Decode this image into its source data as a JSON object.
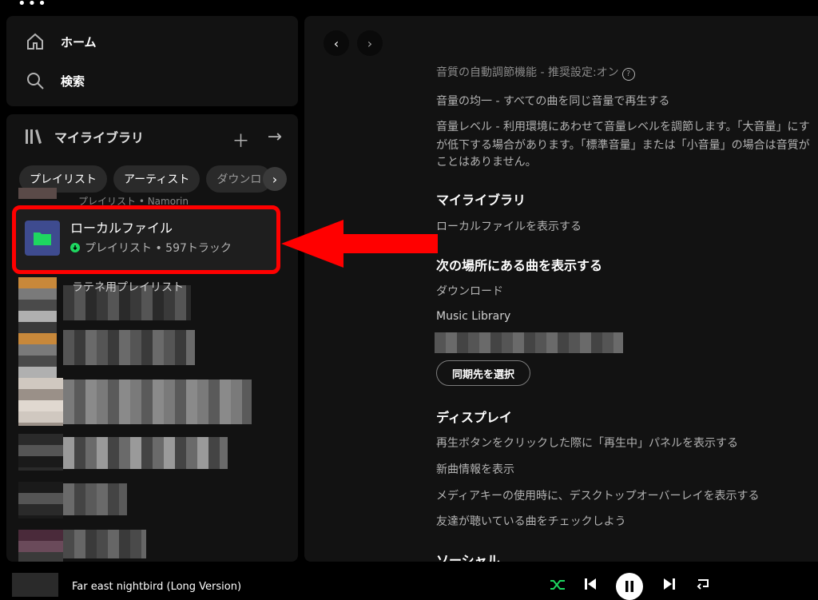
{
  "app": {
    "menu_dots": "•••"
  },
  "nav": {
    "home": "ホーム",
    "search": "検索"
  },
  "library": {
    "title": "マイライブラリ",
    "chips": [
      "プレイリスト",
      "アーティスト",
      "ダウンロ"
    ],
    "partial_top": "プレイリスト • Namorin",
    "selected_item": {
      "title": "ローカルファイル",
      "subtitle": "プレイリスト • 597トラック"
    },
    "partial_mid": "ラテネ用プレイリスト"
  },
  "settings": {
    "top_line": "音質の自動調節機能 - 推奨設定:オン",
    "normalize_line": "音量の均一 - すべての曲を同じ音量で再生する",
    "volume_line1": "音量レベル - 利用環境にあわせて音量レベルを調節します。「大音量」にす",
    "volume_line2": "が低下する場合があります。「標準音量」または「小音量」の場合は音質が",
    "volume_line3": "ことはありません。",
    "library_head": "マイライブラリ",
    "show_local": "ローカルファイルを表示する",
    "sources_head": "次の場所にある曲を表示する",
    "source_download": "ダウンロード",
    "source_music": "Music Library",
    "sync_button": "同期先を選択",
    "display_head": "ディスプレイ",
    "display_1": "再生ボタンをクリックした際に「再生中」パネルを表示する",
    "display_2": "新曲情報を表示",
    "display_3": "メディアキーの使用時に、デスクトップオーバーレイを表示する",
    "display_4": "友達が聴いている曲をチェックしよう",
    "social_head": "ソーシャル"
  },
  "player": {
    "track_title": "Far east nightbird (Long Version)"
  },
  "colors": {
    "accent": "#1ed760",
    "highlight": "#ff0000",
    "folder_bg": "#3e4b8f"
  }
}
